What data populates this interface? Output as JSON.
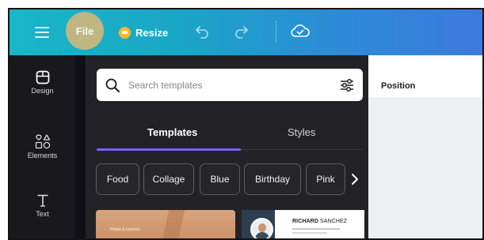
{
  "toolbar": {
    "file_label": "File",
    "resize_label": "Resize",
    "menu_icon": "hamburger-menu-icon",
    "undo_icon": "undo-icon",
    "redo_icon": "redo-icon",
    "cloud_icon": "cloud-sync-icon",
    "crown_icon": "crown-icon"
  },
  "sidebar": {
    "items": [
      {
        "label": "Design",
        "icon": "design-layout-icon"
      },
      {
        "label": "Elements",
        "icon": "elements-shapes-icon"
      },
      {
        "label": "Text",
        "icon": "text-icon"
      }
    ]
  },
  "panel": {
    "search": {
      "placeholder": "Search templates",
      "value": ""
    },
    "tabs": [
      {
        "label": "Templates",
        "active": true
      },
      {
        "label": "Styles",
        "active": false
      }
    ],
    "chips": [
      "Food",
      "Collage",
      "Blue",
      "Birthday",
      "Pink"
    ],
    "templates": [
      {
        "caption": "Plants & Interiors"
      },
      {
        "name_bold": "RICHARD",
        "name_rest": " SANCHEZ"
      }
    ]
  },
  "properties": {
    "title": "Position"
  },
  "colors": {
    "toolbar_start": "#19b6c9",
    "toolbar_end": "#3c79de",
    "accent": "#7d5fff",
    "panel_bg": "#232327",
    "rail_bg": "#19191d"
  }
}
